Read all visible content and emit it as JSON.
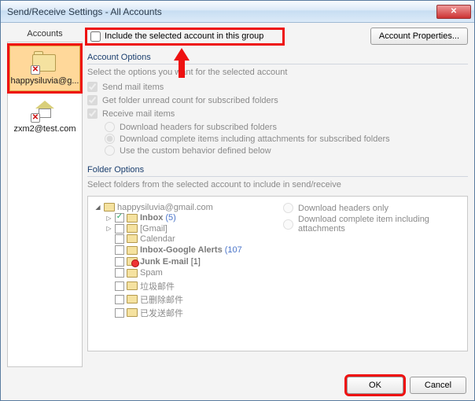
{
  "window": {
    "title": "Send/Receive Settings - All Accounts"
  },
  "sidebar": {
    "header": "Accounts",
    "accounts": [
      {
        "label": "happysiluvia@g...",
        "selected": true
      },
      {
        "label": "zxm2@test.com",
        "selected": false
      }
    ]
  },
  "include": {
    "label": "Include the selected account in this group",
    "checked": false
  },
  "buttons": {
    "account_properties": "Account Properties...",
    "ok": "OK",
    "cancel": "Cancel"
  },
  "account_options": {
    "title": "Account Options",
    "hint": "Select the options you want for the selected account",
    "send_mail": {
      "label": "Send mail items",
      "checked": true
    },
    "folder_unread": {
      "label": "Get folder unread count for subscribed folders",
      "checked": true
    },
    "receive_mail": {
      "label": "Receive mail items",
      "checked": true
    },
    "radios": {
      "headers": "Download headers for subscribed folders",
      "complete": "Download complete items including attachments for subscribed folders",
      "custom": "Use the custom behavior defined below",
      "selected": "complete"
    }
  },
  "folder_options": {
    "title": "Folder Options",
    "hint": "Select folders from the selected account to include in send/receive",
    "root": "happysiluvia@gmail.com",
    "tree": [
      {
        "label": "Inbox",
        "count": "(5)",
        "checked": true,
        "bold": true,
        "expandable": true
      },
      {
        "label": "[Gmail]",
        "checked": false,
        "expandable": true
      },
      {
        "label": "Calendar",
        "checked": false
      },
      {
        "label": "Inbox-Google Alerts",
        "count": "(107",
        "checked": false,
        "bold": true
      },
      {
        "label": "Junk E-mail",
        "count": "[1]",
        "checked": false,
        "bold": true,
        "red": true,
        "dark": true
      },
      {
        "label": "Spam",
        "checked": false
      },
      {
        "label": "垃圾邮件",
        "checked": false
      },
      {
        "label": "已删除邮件",
        "checked": false
      },
      {
        "label": "已发送邮件",
        "checked": false
      }
    ],
    "download": {
      "headers_only": "Download headers only",
      "complete": "Download complete item including attachments"
    }
  }
}
